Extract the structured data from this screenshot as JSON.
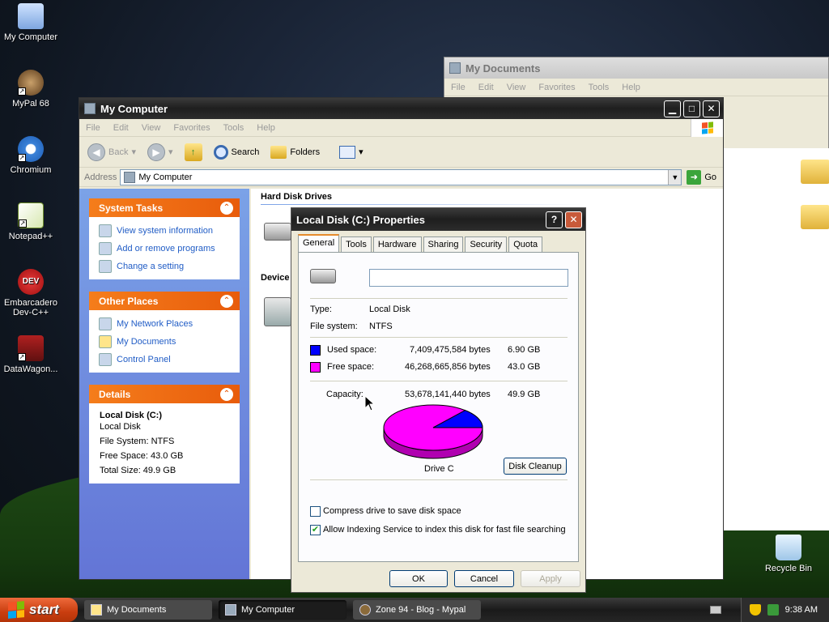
{
  "desktop": {
    "icons": [
      {
        "label": "My Computer"
      },
      {
        "label": "MyPal 68"
      },
      {
        "label": "Chromium"
      },
      {
        "label": "Notepad++"
      },
      {
        "label": "Embarcadero Dev-C++"
      },
      {
        "label": "DataWagon..."
      },
      {
        "label": "Recycle Bin"
      }
    ]
  },
  "mydocs_window": {
    "title": "My Documents",
    "menu": [
      "File",
      "Edit",
      "View",
      "Favorites",
      "Tools",
      "Help"
    ]
  },
  "mycomputer_window": {
    "title": "My Computer",
    "menu": [
      "File",
      "Edit",
      "View",
      "Favorites",
      "Tools",
      "Help"
    ],
    "toolbar": {
      "back": "Back",
      "search": "Search",
      "folders": "Folders"
    },
    "address_label": "Address",
    "address_value": "My Computer",
    "go_label": "Go",
    "system_tasks": {
      "title": "System Tasks",
      "items": [
        "View system information",
        "Add or remove programs",
        "Change a setting"
      ]
    },
    "other_places": {
      "title": "Other Places",
      "items": [
        "My Network Places",
        "My Documents",
        "Control Panel"
      ]
    },
    "details": {
      "title": "Details",
      "name": "Local Disk (C:)",
      "type": "Local Disk",
      "file_system": "File System: NTFS",
      "free_space": "Free Space: 43.0 GB",
      "total_size": "Total Size: 49.9 GB"
    },
    "sections": {
      "hard_disk": "Hard Disk Drives",
      "devices": "Device"
    }
  },
  "properties_dialog": {
    "title": "Local Disk (C:) Properties",
    "tabs": [
      "General",
      "Tools",
      "Hardware",
      "Sharing",
      "Security",
      "Quota"
    ],
    "label_value": "",
    "type_label": "Type:",
    "type_value": "Local Disk",
    "fs_label": "File system:",
    "fs_value": "NTFS",
    "used_label": "Used space:",
    "used_bytes": "7,409,475,584 bytes",
    "used_gb": "6.90 GB",
    "free_label": "Free space:",
    "free_bytes": "46,268,665,856 bytes",
    "free_gb": "43.0 GB",
    "capacity_label": "Capacity:",
    "capacity_bytes": "53,678,141,440 bytes",
    "capacity_gb": "49.9 GB",
    "drive_label": "Drive C",
    "cleanup_label": "Disk Cleanup",
    "compress_label": "Compress drive to save disk space",
    "compress_checked": false,
    "index_label": "Allow Indexing Service to index this disk for fast file searching",
    "index_checked": true,
    "ok_label": "OK",
    "cancel_label": "Cancel",
    "apply_label": "Apply",
    "used_fraction": 0.138,
    "colors": {
      "used": "#0000ff",
      "free": "#ff00ff"
    }
  },
  "taskbar": {
    "start_label": "start",
    "tasks": [
      {
        "label": "My Documents",
        "active": false
      },
      {
        "label": "My Computer",
        "active": true
      },
      {
        "label": "Zone 94 - Blog - Mypal",
        "active": false
      }
    ],
    "clock": "9:38 AM"
  }
}
